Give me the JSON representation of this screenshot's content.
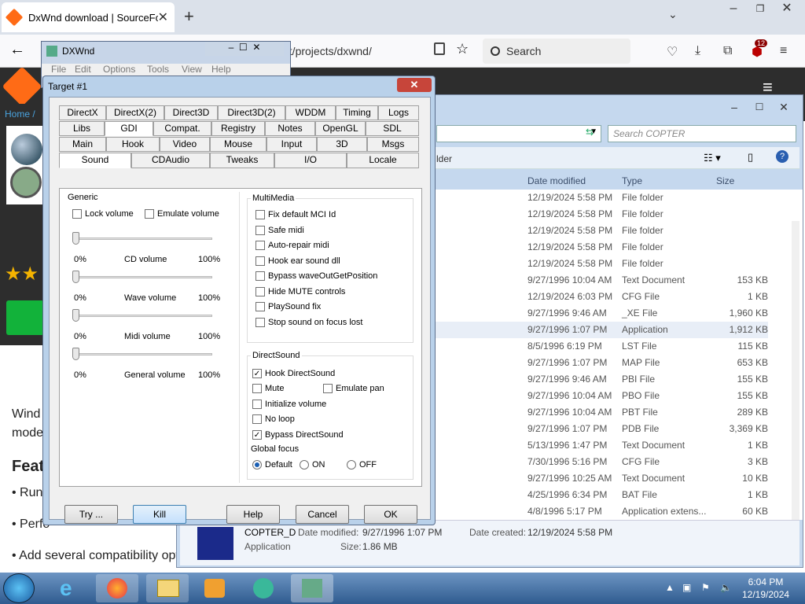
{
  "browser": {
    "tab_title": "DxWnd download | SourceForge",
    "url": "et/projects/dxwnd/",
    "search_placeholder": "Search",
    "badge_count": "12"
  },
  "sourceforge": {
    "breadcrumb": "Home /",
    "text1": "Wind",
    "text2": "mode",
    "feat": "Feat",
    "bullet1": "• Run",
    "bullet2": "• Perfo",
    "bullet3": "• Add several compatibility opt"
  },
  "dxwnd_main": {
    "title": "DXWnd",
    "menu": [
      "File",
      "Edit",
      "Options",
      "Tools",
      "View",
      "Help"
    ]
  },
  "dialog": {
    "title": "Target #1",
    "tabs_row1": [
      "DirectX",
      "DirectX(2)",
      "Direct3D",
      "Direct3D(2)",
      "WDDM",
      "Timing",
      "Logs"
    ],
    "tabs_row2": [
      "Libs",
      "GDI",
      "Compat.",
      "Registry",
      "Notes",
      "OpenGL",
      "SDL"
    ],
    "tabs_row3": [
      "Main",
      "Hook",
      "Video",
      "Mouse",
      "Input",
      "3D",
      "Msgs"
    ],
    "tabs_row4": [
      "Sound",
      "CDAudio",
      "Tweaks",
      "I/O",
      "Locale"
    ],
    "generic": {
      "title": "Generic",
      "lock_volume": "Lock volume",
      "emulate_volume": "Emulate volume",
      "sliders": [
        {
          "min": "0%",
          "label": "CD volume",
          "max": "100%"
        },
        {
          "min": "0%",
          "label": "Wave volume",
          "max": "100%"
        },
        {
          "min": "0%",
          "label": "Midi volume",
          "max": "100%"
        },
        {
          "min": "0%",
          "label": "General volume",
          "max": "100%"
        }
      ]
    },
    "multimedia": {
      "title": "MultiMedia",
      "items": [
        "Fix default MCI Id",
        "Safe midi",
        "Auto-repair midi",
        "Hook ear sound dll",
        "Bypass waveOutGetPosition",
        "Hide MUTE controls",
        "PlaySound fix",
        "Stop sound on focus lost"
      ]
    },
    "directsound": {
      "title": "DirectSound",
      "hook": "Hook DirectSound",
      "mute": "Mute",
      "emulate_pan": "Emulate pan",
      "init_volume": "Initialize volume",
      "no_loop": "No loop",
      "bypass": "Bypass DirectSound",
      "global_focus": "Global focus",
      "radio_default": "Default",
      "radio_on": "ON",
      "radio_off": "OFF"
    },
    "buttons": {
      "try": "Try ...",
      "kill": "Kill",
      "help": "Help",
      "cancel": "Cancel",
      "ok": "OK"
    }
  },
  "explorer": {
    "search_placeholder": "Search COPTER",
    "folder_btn": "lder",
    "columns": {
      "date": "Date modified",
      "type": "Type",
      "size": "Size"
    },
    "rows": [
      {
        "date": "12/19/2024 5:58 PM",
        "type": "File folder",
        "size": ""
      },
      {
        "date": "12/19/2024 5:58 PM",
        "type": "File folder",
        "size": ""
      },
      {
        "date": "12/19/2024 5:58 PM",
        "type": "File folder",
        "size": ""
      },
      {
        "date": "12/19/2024 5:58 PM",
        "type": "File folder",
        "size": ""
      },
      {
        "date": "12/19/2024 5:58 PM",
        "type": "File folder",
        "size": ""
      },
      {
        "date": "9/27/1996 10:04 AM",
        "type": "Text Document",
        "size": "153 KB"
      },
      {
        "date": "12/19/2024 6:03 PM",
        "type": "CFG File",
        "size": "1 KB"
      },
      {
        "date": "9/27/1996 9:46 AM",
        "type": "_XE File",
        "size": "1,960 KB"
      },
      {
        "date": "9/27/1996 1:07 PM",
        "type": "Application",
        "size": "1,912 KB"
      },
      {
        "date": "8/5/1996 6:19 PM",
        "type": "LST File",
        "size": "115 KB"
      },
      {
        "date": "9/27/1996 1:07 PM",
        "type": "MAP File",
        "size": "653 KB"
      },
      {
        "date": "9/27/1996 9:46 AM",
        "type": "PBI File",
        "size": "155 KB"
      },
      {
        "date": "9/27/1996 10:04 AM",
        "type": "PBO File",
        "size": "155 KB"
      },
      {
        "date": "9/27/1996 10:04 AM",
        "type": "PBT File",
        "size": "289 KB"
      },
      {
        "date": "9/27/1996 1:07 PM",
        "type": "PDB File",
        "size": "3,369 KB"
      },
      {
        "date": "5/13/1996 1:47 PM",
        "type": "Text Document",
        "size": "1 KB"
      },
      {
        "date": "7/30/1996 5:16 PM",
        "type": "CFG File",
        "size": "3 KB"
      },
      {
        "date": "9/27/1996 10:25 AM",
        "type": "Text Document",
        "size": "10 KB"
      },
      {
        "date": "4/25/1996 6:34 PM",
        "type": "BAT File",
        "size": "1 KB"
      },
      {
        "date": "4/8/1996 5:17 PM",
        "type": "Application extens...",
        "size": "60 KB"
      }
    ],
    "status": {
      "name": "COPTER_D",
      "date_modified_label": "Date modified:",
      "date_modified": "9/27/1996 1:07 PM",
      "date_created_label": "Date created:",
      "date_created": "12/19/2024 5:58 PM",
      "kind": "Application",
      "size_label": "Size:",
      "size": "1.86 MB"
    }
  },
  "taskbar": {
    "time": "6:04 PM",
    "date": "12/19/2024"
  }
}
